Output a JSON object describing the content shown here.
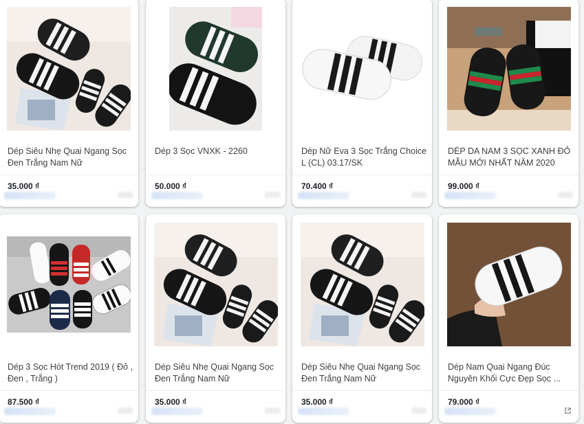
{
  "products": [
    {
      "title": "Dép Siêu Nhẹ Quai Ngang Sọc Đen Trắng Nam Nữ",
      "price": "35.000 ₫",
      "image": "black-white-stripe-slides"
    },
    {
      "title": "Dép 3 Sọc VNXK - 2260",
      "price": "50.000 ₫",
      "image": "dark-green-black-stripe-slides"
    },
    {
      "title": "Dép Nữ Eva 3 Sọc Trắng Choice L (CL) 03.17/SK",
      "price": "70.400 ₫",
      "image": "white-black-stripe-slides"
    },
    {
      "title": "DÉP DA NAM 3 SỌC XANH ĐỎ MẪU MỚI NHẤT NĂM 2020",
      "price": "99.000 ₫",
      "image": "black-green-red-stripe-slides"
    },
    {
      "title": "Dép 3 Sọc Hót Trend 2019 ( Đỏ , Đen , Trắng )",
      "price": "87.500 ₫",
      "image": "assorted-color-stripe-slides"
    },
    {
      "title": "Dép Siêu Nhẹ Quai Ngang Sọc Đen Trắng Nam Nữ",
      "price": "35.000 ₫",
      "image": "black-white-stripe-slides"
    },
    {
      "title": "Dép Siêu Nhẹ Quai Ngang Sọc Đen Trắng Nam Nữ",
      "price": "35.000 ₫",
      "image": "black-white-stripe-slides"
    },
    {
      "title": "Dép Nam Quai Ngang Đúc Nguyên Khối Cực Đẹp Sọc ...",
      "price": "79.000 ₫",
      "image": "white-slide-in-hand"
    }
  ],
  "icons": {
    "external_link": "external-link-icon"
  },
  "colors": {
    "price": "#202124",
    "title": "#3c4043",
    "background": "#f1f3f4"
  }
}
